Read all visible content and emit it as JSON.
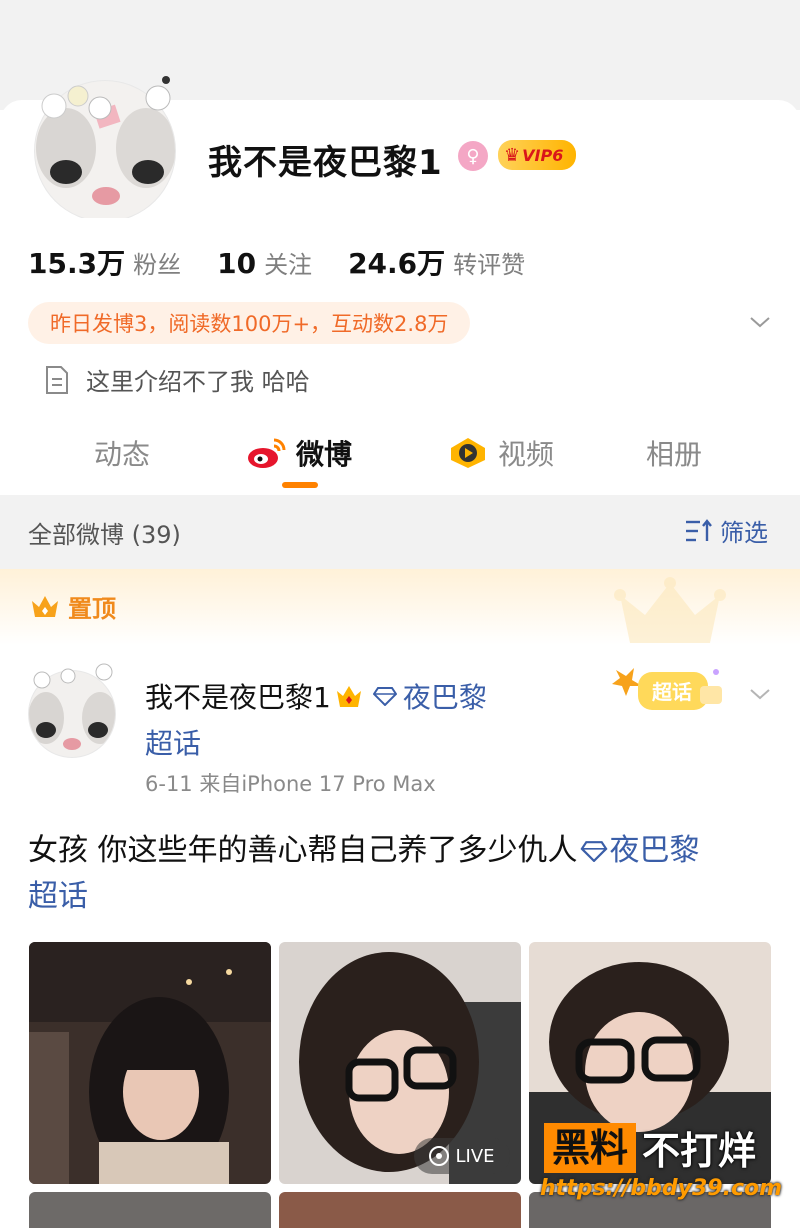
{
  "profile": {
    "nickname": "我不是夜巴黎1",
    "gender_icon": "female-icon",
    "vip_label": "VIP6",
    "stats": [
      {
        "value": "15.3万",
        "label": "粉丝"
      },
      {
        "value": "10",
        "label": "关注"
      },
      {
        "value": "24.6万",
        "label": "转评赞"
      }
    ],
    "activity": "昨日发博3，阅读数100万+，互动数2.8万",
    "bio": "这里介绍不了我 哈哈"
  },
  "tabs": [
    {
      "label": "动态",
      "icon": ""
    },
    {
      "label": "微博",
      "icon": "weibo-logo-icon"
    },
    {
      "label": "视频",
      "icon": "video-play-icon"
    },
    {
      "label": "相册",
      "icon": ""
    }
  ],
  "active_tab": "微博",
  "filter": {
    "count_label": "全部微博 (39)",
    "filter_label": "筛选"
  },
  "pinned": {
    "label": "置顶"
  },
  "post": {
    "author": "我不是夜巴黎1",
    "topic": "夜巴黎",
    "topic_suffix": "超话",
    "meta": "6-11  来自iPhone 17 Pro Max",
    "badge": "超话",
    "text": "女孩 你这些年的善心帮自己养了多少仇人",
    "text_topic": "夜巴黎",
    "text_topic_suffix": "超话",
    "live_label": "LIVE"
  },
  "watermark": {
    "box_text": "黑料",
    "rest_text": "不打烊",
    "url": "https://bbdy39.com"
  },
  "colors": {
    "accent_orange": "#ff8200",
    "link_blue": "#3a5ea8",
    "activity_text": "#f06a28",
    "activity_bg": "#fff1e6",
    "vip_gold": "#ffb400"
  }
}
